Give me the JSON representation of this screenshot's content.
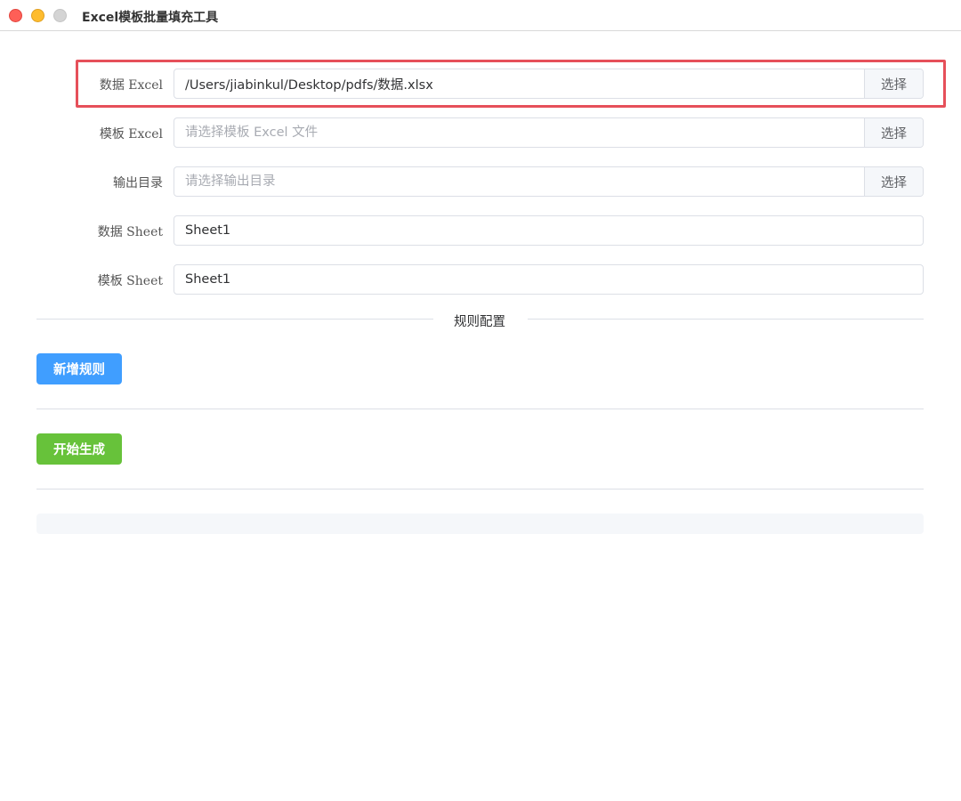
{
  "window": {
    "title": "Excel模板批量填充工具"
  },
  "form": {
    "data_excel": {
      "label": "数据 Excel",
      "value": "/Users/jiabinkul/Desktop/pdfs/数据.xlsx",
      "placeholder": "",
      "button": "选择"
    },
    "template_excel": {
      "label": "模板 Excel",
      "value": "",
      "placeholder": "请选择模板 Excel 文件",
      "button": "选择"
    },
    "output_dir": {
      "label": "输出目录",
      "value": "",
      "placeholder": "请选择输出目录",
      "button": "选择"
    },
    "data_sheet": {
      "label": "数据 Sheet",
      "value": "Sheet1"
    },
    "template_sheet": {
      "label": "模板 Sheet",
      "value": "Sheet1"
    }
  },
  "rules": {
    "divider_label": "规则配置",
    "add_rule_button": "新增规则"
  },
  "actions": {
    "generate_button": "开始生成"
  },
  "progress": {
    "value": 0
  },
  "colors": {
    "primary": "#409eff",
    "success": "#67c23a",
    "highlight": "#e6505a"
  }
}
